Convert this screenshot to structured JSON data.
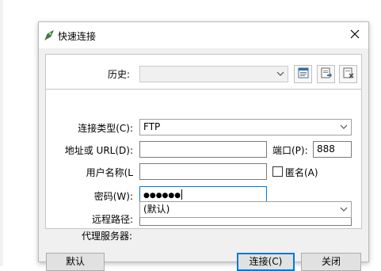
{
  "dialog": {
    "title": "快速连接",
    "icons": {
      "app": "rocket-icon",
      "close": "close-icon"
    }
  },
  "history": {
    "label": "历史:",
    "value": "",
    "tool_icons": [
      "window-icon",
      "export-icon",
      "delete-icon"
    ]
  },
  "form": {
    "conn_type_label": "连接类型(C):",
    "conn_type_value": "FTP",
    "address_label": "地址或 URL(D):",
    "address_value": "",
    "port_label": "端口(P):",
    "port_value": "888",
    "username_label": "用户名称(L",
    "username_value": "",
    "anonymous_label": "匿名(A)",
    "anonymous_checked": false,
    "password_label": "密码(W):",
    "password_value": "●●●●●●",
    "remote_path_label": "远程路径:",
    "remote_path_value": "",
    "proxy_label": "代理服务器:",
    "proxy_value": "(默认)"
  },
  "buttons": {
    "default_label": "默认",
    "connect_label": "连接(C)",
    "close_label": "关闭"
  },
  "colors": {
    "accent": "#0078d7",
    "window_bg": "#f0f0f0",
    "group_bg": "#ffffff"
  }
}
